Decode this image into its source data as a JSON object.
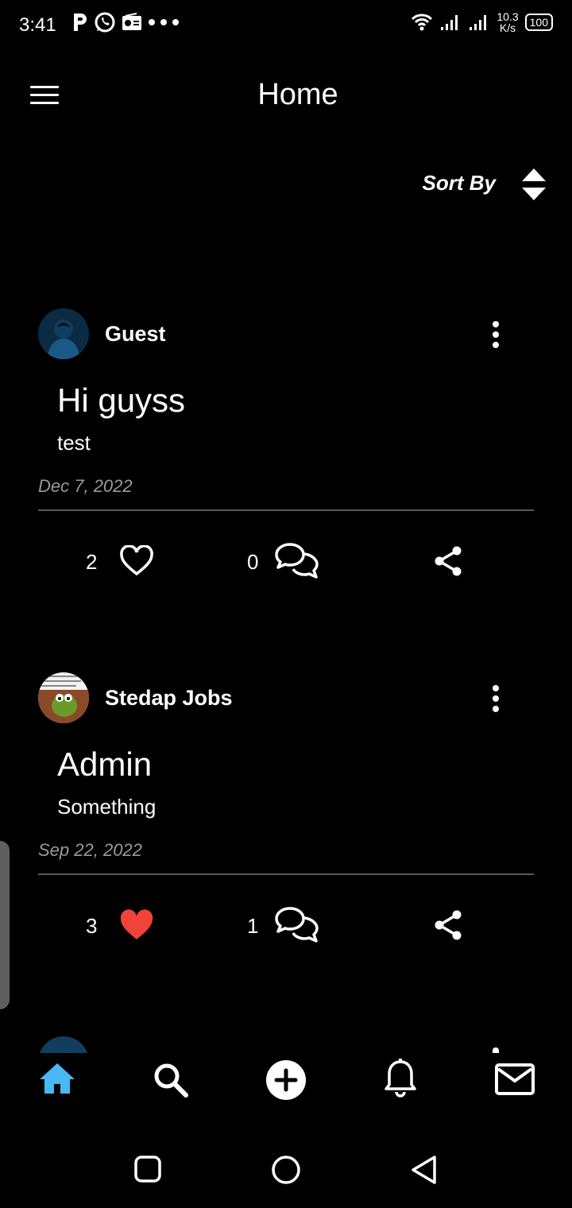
{
  "status_bar": {
    "time": "3:41",
    "speed_value": "10.3",
    "speed_unit": "K/s",
    "battery": "100",
    "icons": [
      "p-app-icon",
      "whatsapp-icon",
      "radio-icon",
      "more-dots-icon",
      "wifi-icon",
      "signal-icon",
      "signal-icon"
    ]
  },
  "header": {
    "title": "Home",
    "sort_label": "Sort By",
    "menu_icon": "hamburger-menu-icon",
    "sort_icon": "sort-arrows-icon"
  },
  "posts": [
    {
      "author": "Guest",
      "title": "Hi guyss",
      "body": "test",
      "date": "Dec 7, 2022",
      "likes": "2",
      "liked": false,
      "comments": "0"
    },
    {
      "author": "Stedap Jobs",
      "title": "Admin",
      "body": "Something",
      "date": "Sep 22, 2022",
      "likes": "3",
      "liked": true,
      "comments": "1"
    }
  ],
  "bottom_nav": {
    "items": [
      "home-icon",
      "search-icon",
      "add-post-icon",
      "notifications-icon",
      "messages-icon"
    ],
    "active": "home-icon"
  },
  "colors": {
    "background": "#000000",
    "accent_active": "#4ab8f5",
    "like_red": "#f04438",
    "date_gray": "#9a9a9a"
  }
}
